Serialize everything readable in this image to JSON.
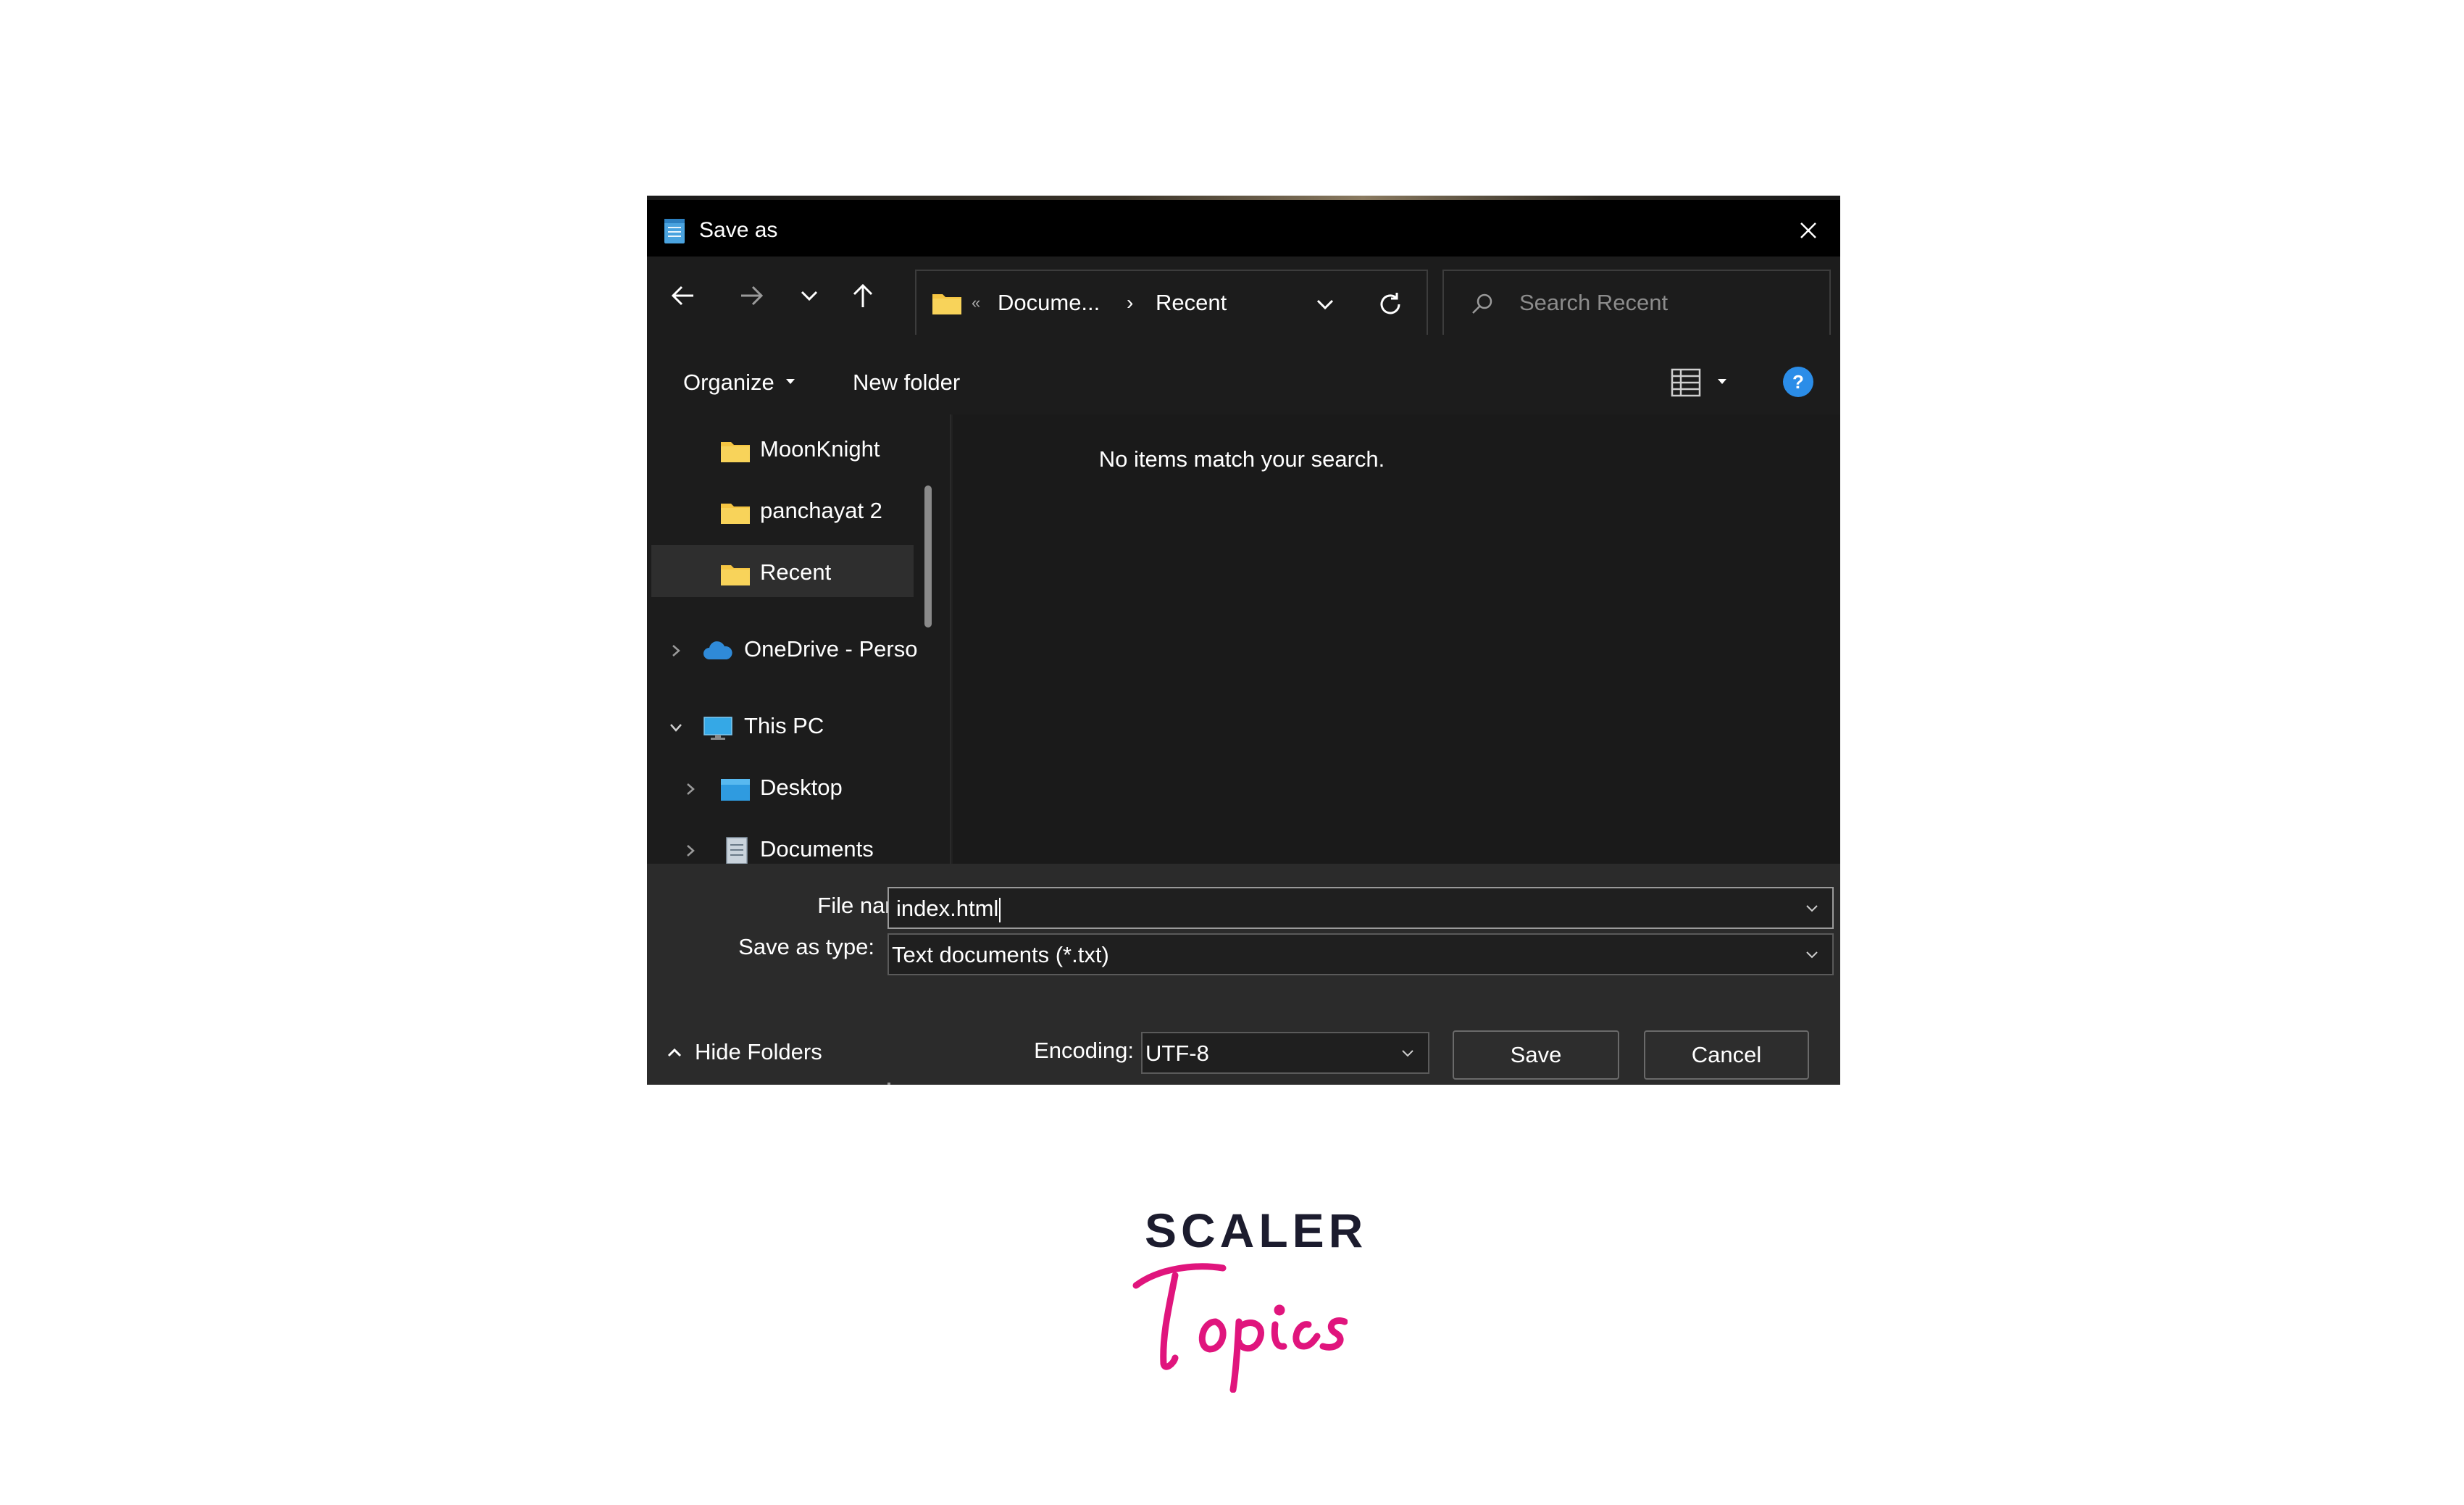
{
  "dialog": {
    "title": "Save as",
    "app_icon": "notepad-icon",
    "close_icon": "close-icon"
  },
  "nav": {
    "back_icon": "arrow-left-icon",
    "forward_icon": "arrow-right-icon",
    "recent_dropdown_icon": "chevron-down-icon",
    "up_icon": "arrow-up-icon",
    "address": {
      "separator": "«",
      "crumbs": [
        "Docume...",
        "Recent"
      ],
      "crumb_separator": "›",
      "dropdown_icon": "chevron-down-icon",
      "refresh_icon": "refresh-icon"
    },
    "search": {
      "placeholder": "Search Recent",
      "icon": "search-icon"
    }
  },
  "toolbar": {
    "organize_label": "Organize",
    "new_folder_label": "New folder",
    "view_icon": "details-view-icon",
    "help_icon": "help-icon"
  },
  "navpane": {
    "items": [
      {
        "label": "MoonKnight",
        "icon": "folder-icon"
      },
      {
        "label": "panchayat 2",
        "icon": "folder-icon"
      },
      {
        "label": "Recent",
        "icon": "folder-icon",
        "selected": true
      },
      {
        "label": "OneDrive - Perso",
        "icon": "cloud-icon",
        "expandable": true
      },
      {
        "label": "This PC",
        "icon": "monitor-icon",
        "expanded": true
      },
      {
        "label": "Desktop",
        "icon": "desktop-folder-icon",
        "expandable": true
      },
      {
        "label": "Documents",
        "icon": "documents-icon",
        "expandable": true
      }
    ]
  },
  "content": {
    "empty_message": "No items match your search."
  },
  "form": {
    "file_name_label": "File name:",
    "file_name_value": "index.html",
    "save_as_type_label": "Save as type:",
    "save_as_type_value": "Text documents (*.txt)",
    "encoding_label": "Encoding:",
    "encoding_value": "UTF-8",
    "hide_folders_label": "Hide Folders",
    "save_label": "Save",
    "cancel_label": "Cancel"
  },
  "colors": {
    "dialog_bg": "#202020",
    "titlebar_bg": "#000000",
    "folder_yellow": "#f5c542",
    "help_blue": "#2b8de8",
    "logo_pink": "#e0157d",
    "logo_dark": "#1c1c2e"
  },
  "logo": {
    "word": "SCALER",
    "script": "Topics"
  }
}
